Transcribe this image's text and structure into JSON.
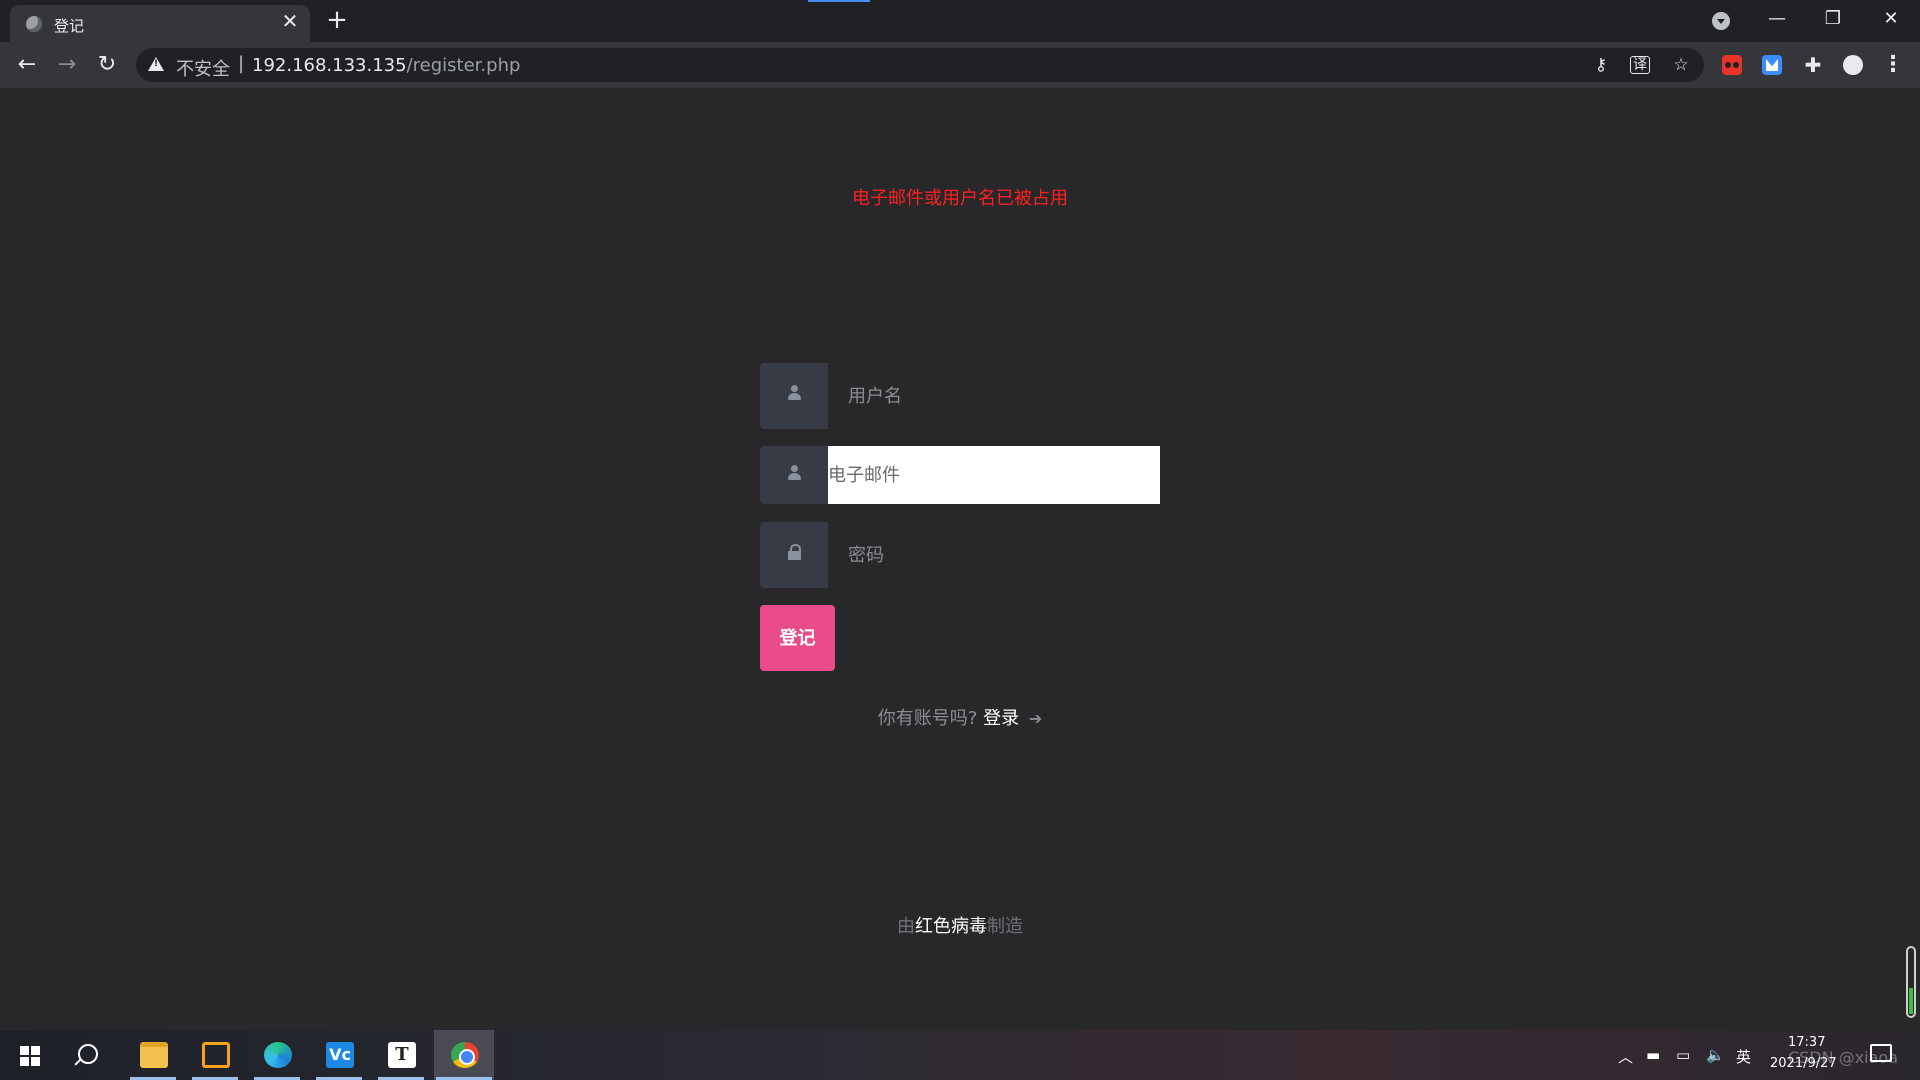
{
  "browser": {
    "tab_title": "登记",
    "tab_close": "✕",
    "new_tab": "+",
    "window_min": "—",
    "window_max": "❐",
    "window_close": "✕",
    "back": "←",
    "forward": "→",
    "reload": "↻",
    "security_label": "不安全",
    "separator": "|",
    "url_host": "192.168.133.135",
    "url_path": "/register.php",
    "menu": "⋮",
    "puzzle": "✚",
    "star": "☆",
    "key": "⚷",
    "translate": "译"
  },
  "page": {
    "error_message": "电子邮件或用户名已被占用",
    "username_placeholder": "用户名",
    "email_placeholder": "电子邮件",
    "password_placeholder": "密码",
    "register_button": "登记",
    "login_prompt": "你有账号吗?",
    "login_link": "登录",
    "login_arrow": "➔",
    "footer_prefix": "由",
    "footer_name": "红色病毒",
    "footer_suffix": "制造"
  },
  "taskbar": {
    "typora_letter": "T",
    "vc_label": "Vc",
    "tray_up": "︿",
    "tray_batt": "▬",
    "tray_net": "▭",
    "tray_vol": "🔈",
    "ime": "英",
    "time": "17:37",
    "date": "2021/9/27",
    "watermark": "CSDN @xiaoa"
  },
  "colors": {
    "accent": "#ea4c89",
    "error": "#ff1f1f",
    "background": "#28282a"
  }
}
